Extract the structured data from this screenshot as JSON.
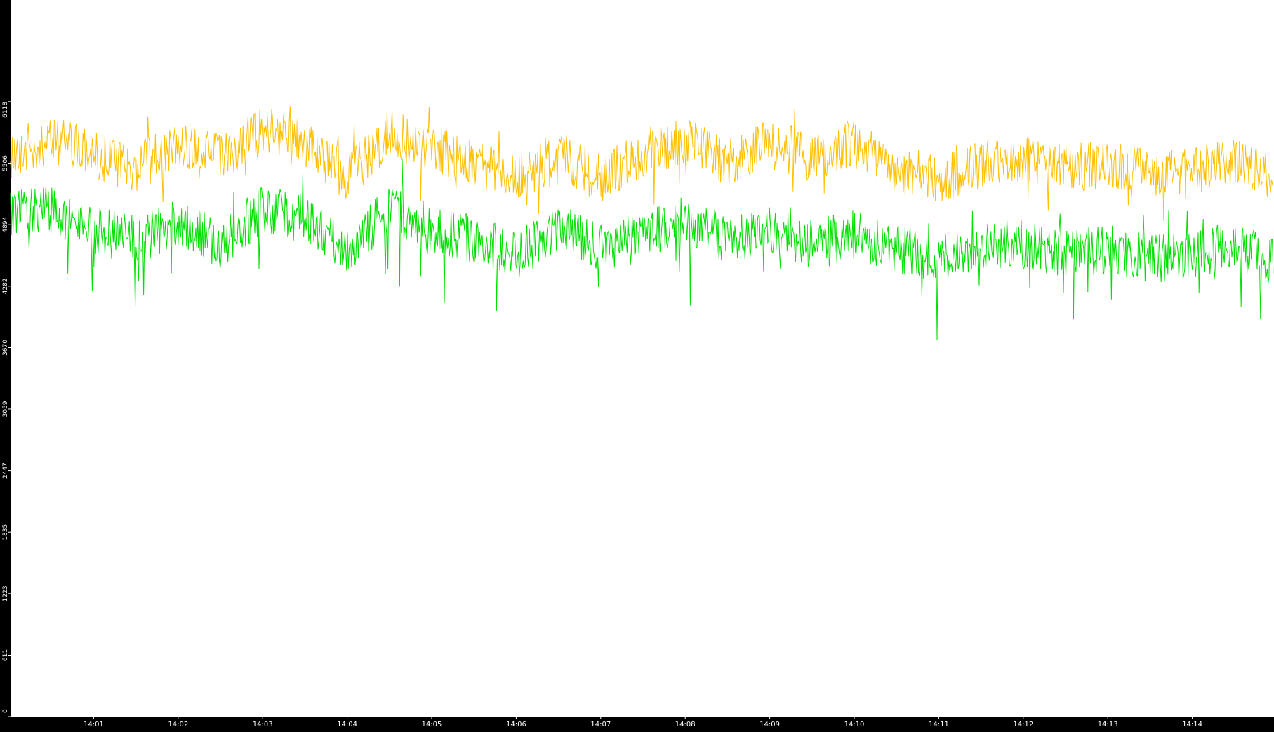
{
  "chart_data": {
    "type": "line",
    "title": "",
    "xlabel": "",
    "ylabel": "",
    "ylim": [
      0,
      7130
    ],
    "y_ticks": [
      "0",
      "611",
      "1223",
      "1835",
      "2447",
      "3059",
      "3670",
      "4282",
      "4894",
      "5506",
      "6118"
    ],
    "x_ticks": [
      "14:01",
      "14:02",
      "14:03",
      "14:04",
      "14:05",
      "14:06",
      "14:07",
      "14:08",
      "14:09",
      "14:10",
      "14:11",
      "14:12",
      "14:13",
      "14:14"
    ],
    "x_range": [
      "14:00:01",
      "14:14:58"
    ],
    "grid": false,
    "legend": "none",
    "series": [
      {
        "color": "#ffc000",
        "x": [
          "14:00:01",
          "14:00:30",
          "14:01:00",
          "14:01:30",
          "14:02:00",
          "14:02:30",
          "14:03:00",
          "14:03:30",
          "14:04:00",
          "14:04:30",
          "14:05:00",
          "14:05:30",
          "14:06:00",
          "14:06:30",
          "14:07:00",
          "14:07:30",
          "14:08:00",
          "14:08:30",
          "14:09:00",
          "14:09:30",
          "14:10:00",
          "14:10:30",
          "14:11:00",
          "14:11:30",
          "14:12:00",
          "14:12:30",
          "14:13:00",
          "14:13:30",
          "14:14:00",
          "14:14:30",
          "14:14:58"
        ],
        "values": [
          5600,
          5750,
          5600,
          5450,
          5700,
          5550,
          5850,
          5700,
          5350,
          5800,
          5650,
          5500,
          5350,
          5600,
          5350,
          5600,
          5750,
          5500,
          5700,
          5550,
          5700,
          5450,
          5350,
          5500,
          5550,
          5450,
          5500,
          5400,
          5400,
          5550,
          5300
        ]
      },
      {
        "color": "#00e000",
        "x": [
          "14:00:01",
          "14:00:30",
          "14:01:00",
          "14:01:30",
          "14:02:00",
          "14:02:30",
          "14:03:00",
          "14:03:30",
          "14:04:00",
          "14:04:30",
          "14:05:00",
          "14:05:30",
          "14:06:00",
          "14:06:30",
          "14:07:00",
          "14:07:30",
          "14:08:00",
          "14:08:30",
          "14:09:00",
          "14:09:30",
          "14:10:00",
          "14:10:30",
          "14:11:00",
          "14:11:30",
          "14:12:00",
          "14:12:30",
          "14:13:00",
          "14:13:30",
          "14:14:00",
          "14:14:30",
          "14:14:58"
        ],
        "values": [
          5000,
          5050,
          4850,
          4750,
          4900,
          4700,
          5050,
          4950,
          4650,
          5050,
          4850,
          4750,
          4600,
          4850,
          4650,
          4800,
          4950,
          4750,
          4850,
          4700,
          4800,
          4650,
          4550,
          4700,
          4700,
          4600,
          4650,
          4550,
          4600,
          4700,
          4500
        ]
      }
    ]
  }
}
